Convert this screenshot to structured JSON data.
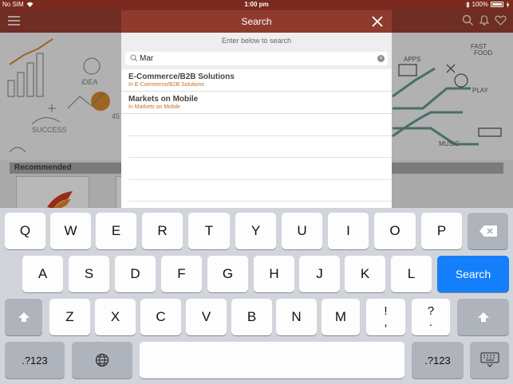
{
  "status_bar": {
    "carrier": "No SIM",
    "time": "1:00 pm",
    "battery": "100%"
  },
  "background": {
    "recommended_label": "Recommended"
  },
  "modal": {
    "title": "Search",
    "subtitle": "Enter below to search",
    "search_value": "Mar",
    "results": [
      {
        "title": "E-Commerce/B2B Solutions",
        "category": "In E-Commerce/B2B Solutions"
      },
      {
        "title": "Markets on Mobile",
        "category": "In Markets on Mobile"
      }
    ]
  },
  "keyboard": {
    "row1": [
      "Q",
      "W",
      "E",
      "R",
      "T",
      "Y",
      "U",
      "I",
      "O",
      "P"
    ],
    "row2": [
      "A",
      "S",
      "D",
      "F",
      "G",
      "H",
      "J",
      "K",
      "L"
    ],
    "row3": [
      "Z",
      "X",
      "C",
      "V",
      "B",
      "N",
      "M"
    ],
    "punct1": [
      "!",
      ","
    ],
    "punct2": [
      "?",
      "."
    ],
    "search_label": "Search",
    "numbers_label": ".?123"
  },
  "colors": {
    "brand": "#8e3b2e",
    "accent_link": "#c0702a",
    "keyboard_blue": "#147efb"
  }
}
